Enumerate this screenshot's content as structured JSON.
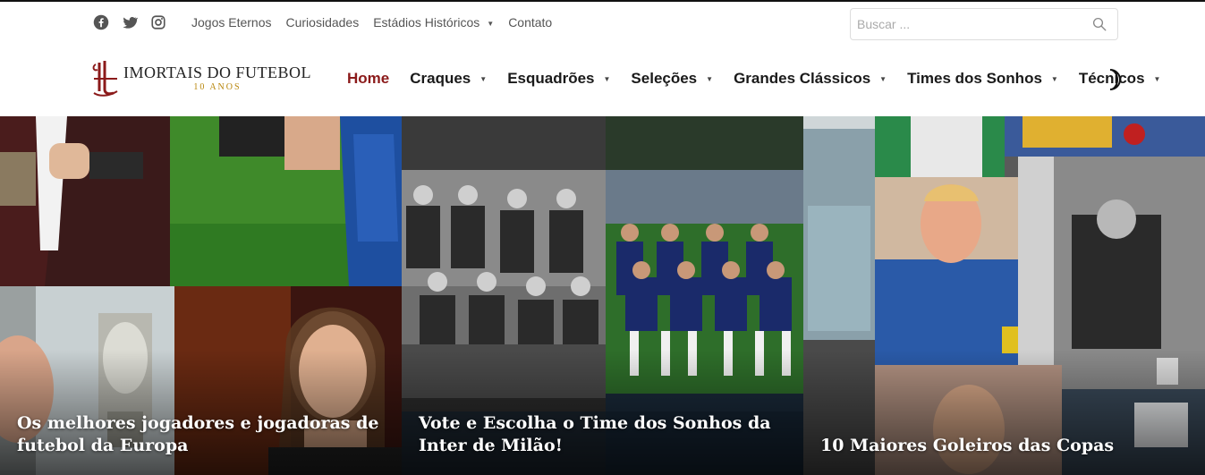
{
  "topbar": {
    "social": [
      {
        "icon": "facebook-icon"
      },
      {
        "icon": "twitter-icon"
      },
      {
        "icon": "instagram-icon"
      }
    ],
    "links": [
      "Jogos Eternos",
      "Curiosidades",
      "Estádios Históricos",
      "Contato"
    ],
    "search_placeholder": "Buscar ..."
  },
  "brand": {
    "title": "IMORTAIS DO FUTEBOL",
    "subtitle": "10 ANOS",
    "accent_color": "#8b1a1a",
    "gold_color": "#b8860b"
  },
  "mainnav": {
    "items": [
      "Home",
      "Craques",
      "Esquadrões",
      "Seleções",
      "Grandes Clássicos",
      "Times dos Sonhos",
      "Técnicos"
    ],
    "active": "Home"
  },
  "hero": {
    "cards": [
      {
        "title": "Os melhores jogadores e jogadoras de futebol da Europa"
      },
      {
        "title": "Vote e Escolha o Time dos Sonhos da Inter de Milão!"
      },
      {
        "title": "10 Maiores Goleiros das Copas"
      }
    ]
  }
}
